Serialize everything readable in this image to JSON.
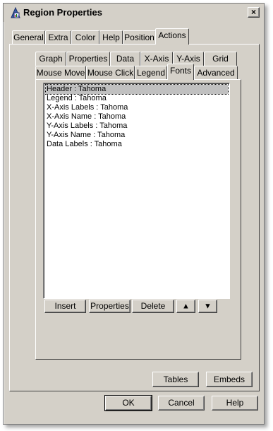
{
  "window": {
    "title": "Region Properties",
    "icon": "chart-app-icon",
    "close_label": "×"
  },
  "outer_tabs": [
    {
      "label": "General",
      "active": false
    },
    {
      "label": "Extra",
      "active": false
    },
    {
      "label": "Color",
      "active": false
    },
    {
      "label": "Help",
      "active": false
    },
    {
      "label": "Position",
      "active": false
    },
    {
      "label": "Actions",
      "active": true
    }
  ],
  "inner_tabs_row1": [
    {
      "label": "Graph"
    },
    {
      "label": "Properties"
    },
    {
      "label": "Data"
    },
    {
      "label": "X-Axis"
    },
    {
      "label": "Y-Axis"
    },
    {
      "label": "Grid"
    }
  ],
  "inner_tabs_row2": [
    {
      "label": "Mouse Move",
      "active": false
    },
    {
      "label": "Mouse Click",
      "active": false
    },
    {
      "label": "Legend",
      "active": false
    },
    {
      "label": "Fonts",
      "active": true
    },
    {
      "label": "Advanced",
      "active": false
    }
  ],
  "fonts_list": {
    "selected_index": 0,
    "items": [
      "Header : Tahoma",
      "Legend : Tahoma",
      "X-Axis Labels : Tahoma",
      "X-Axis Name : Tahoma",
      "Y-Axis Labels : Tahoma",
      "Y-Axis Name : Tahoma",
      "Data Labels : Tahoma"
    ]
  },
  "list_buttons": {
    "insert": "Insert",
    "properties": "Properties",
    "delete": "Delete",
    "move_up_icon": "arrow-up-icon",
    "move_down_icon": "arrow-down-icon"
  },
  "panel_buttons": {
    "tables": "Tables",
    "embeds": "Embeds"
  },
  "dialog_buttons": {
    "ok": "OK",
    "cancel": "Cancel",
    "help": "Help"
  }
}
